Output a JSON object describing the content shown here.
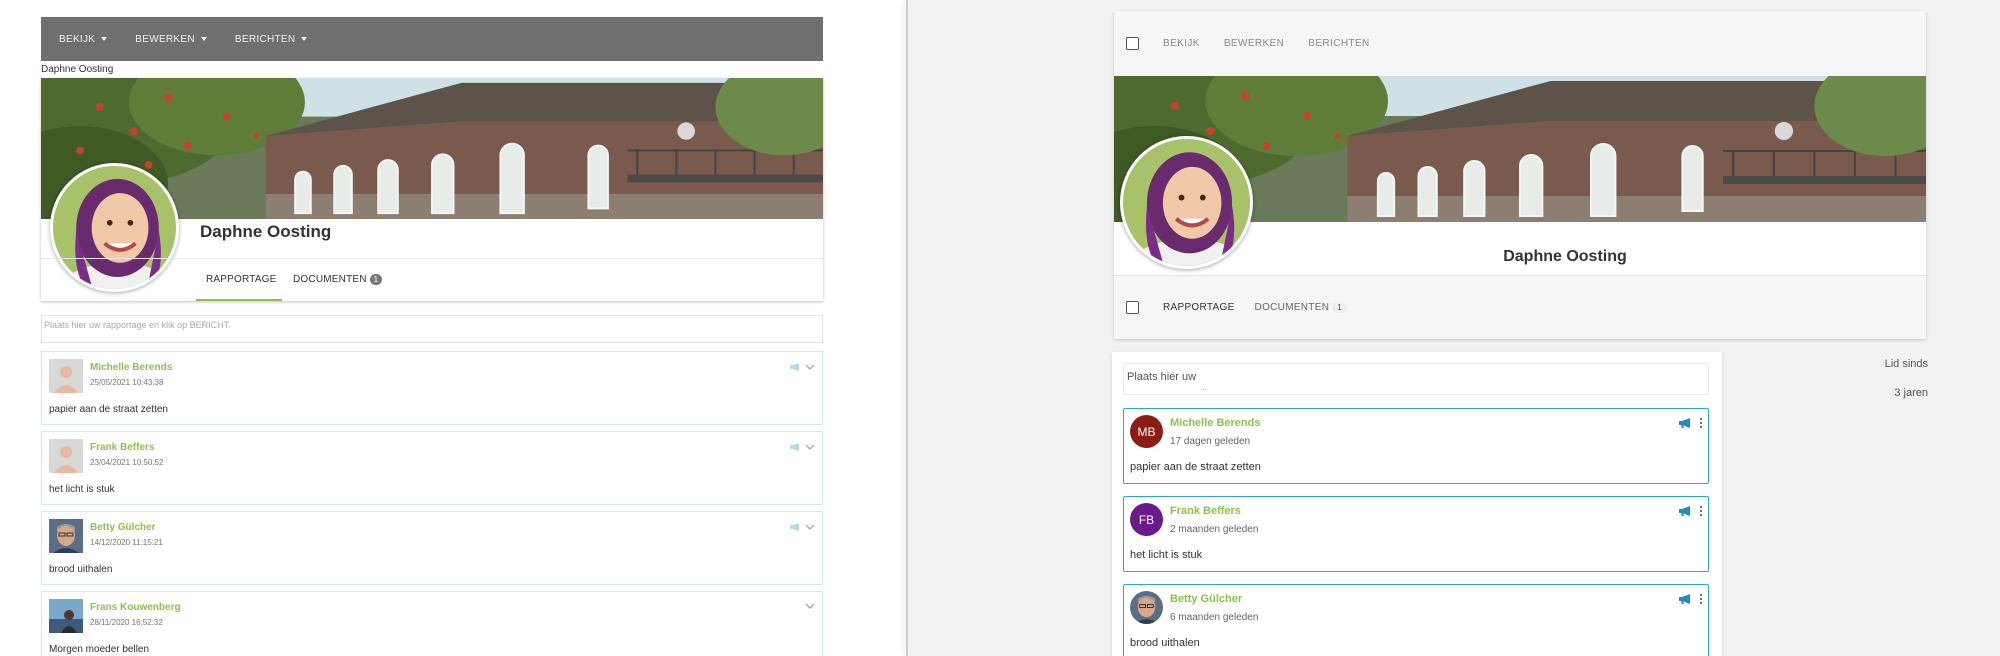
{
  "old": {
    "menu": [
      {
        "label": "BEKIJK"
      },
      {
        "label": "BEWERKEN"
      },
      {
        "label": "BERICHTEN"
      }
    ],
    "breadcrumb_name": "Daphne Oosting",
    "profile_name": "Daphne Oosting",
    "tabs": {
      "rapportage": "RAPPORTAGE",
      "documenten": "DOCUMENTEN",
      "documenten_count": "1"
    },
    "post_placeholder": "Plaats hier uw rapportage en klik op BERICHT.",
    "posts": [
      {
        "author": "Michelle Berends",
        "timestamp": "25/05/2021 10:43:38",
        "message": "papier aan de straat zetten"
      },
      {
        "author": "Frank Beffers",
        "timestamp": "23/04/2021 10:50:52",
        "message": "het licht is stuk"
      },
      {
        "author": "Betty Gülcher",
        "timestamp": "14/12/2020 11:15:21",
        "message": "brood uithalen"
      },
      {
        "author": "Frans Kouwenberg",
        "timestamp": "28/11/2020 16:52:32",
        "message": "Morgen moeder bellen"
      }
    ]
  },
  "new": {
    "menu": [
      {
        "label": "BEKIJK"
      },
      {
        "label": "BEWERKEN"
      },
      {
        "label": "BERICHTEN"
      }
    ],
    "profile_name": "Daphne Oosting",
    "tabs": {
      "rapportage": "RAPPORTAGE",
      "documenten": "DOCUMENTEN",
      "documenten_count": "1"
    },
    "post_input_text": "Plaats hier uw",
    "post_input_dots": "...",
    "posts": [
      {
        "author": "Michelle Berends",
        "initials": "MB",
        "ago": "17 dagen geleden",
        "message": "papier aan de straat zetten"
      },
      {
        "author": "Frank Beffers",
        "initials": "FB",
        "ago": "2 maanden geleden",
        "message": "het licht is stuk"
      },
      {
        "author": "Betty Gülcher",
        "initials": "",
        "ago": "6 maanden geleden",
        "message": "brood uithalen"
      }
    ],
    "sidebar": {
      "member_since_label": "Lid sinds",
      "member_since_value": "3 jaren"
    }
  },
  "colors": {
    "accent_green": "#8bc34a",
    "card_border_blue": "#29a9c5",
    "megaphone_blue": "#1a8fc1",
    "avatar_mb": "#8a1d14",
    "avatar_fb": "#6a1a8c",
    "old_toolbar": "#6f6f6f"
  },
  "icons": {
    "old_caret": "caret-down-icon",
    "old_megaphone": "megaphone-icon",
    "old_chevron": "chevron-down-icon",
    "new_megaphone": "megaphone-icon",
    "new_kebab": "more-vert-icon"
  }
}
